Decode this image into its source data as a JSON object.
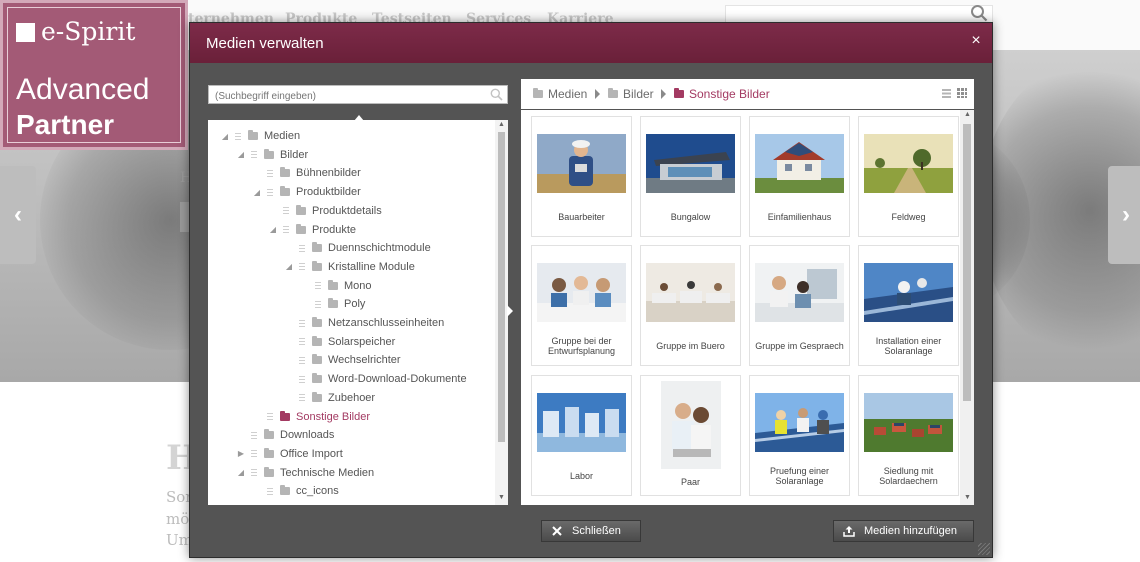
{
  "background": {
    "nav_links": [
      "ternehmen",
      "Produkte",
      "Testseiten",
      "Services",
      "Karriere"
    ],
    "side_heading": "H",
    "heading": "H",
    "paragraph_lines": [
      "Sor",
      "mö",
      "Um"
    ]
  },
  "logo": {
    "brand": "e-Spirit",
    "line1": "Advanced",
    "line2": "Partner"
  },
  "modal": {
    "title": "Medien verwalten",
    "close_glyph": "×",
    "search_placeholder": "(Suchbegriff eingeben)",
    "tree": [
      {
        "label": "Medien",
        "toggle": "◢",
        "active": false
      },
      {
        "label": "Bilder",
        "toggle": "◢",
        "active": false
      },
      {
        "label": "Bühnenbilder",
        "toggle": "",
        "active": false
      },
      {
        "label": "Produktbilder",
        "toggle": "◢",
        "active": false
      },
      {
        "label": "Produktdetails",
        "toggle": "",
        "active": false
      },
      {
        "label": "Produkte",
        "toggle": "◢",
        "active": false
      },
      {
        "label": "Duennschichtmodule",
        "toggle": "",
        "active": false
      },
      {
        "label": "Kristalline Module",
        "toggle": "◢",
        "active": false
      },
      {
        "label": "Mono",
        "toggle": "",
        "active": false
      },
      {
        "label": "Poly",
        "toggle": "",
        "active": false
      },
      {
        "label": "Netzanschlusseinheiten",
        "toggle": "",
        "active": false
      },
      {
        "label": "Solarspeicher",
        "toggle": "",
        "active": false
      },
      {
        "label": "Wechselrichter",
        "toggle": "",
        "active": false
      },
      {
        "label": "Word-Download-Dokumente",
        "toggle": "",
        "active": false
      },
      {
        "label": "Zubehoer",
        "toggle": "",
        "active": false
      },
      {
        "label": "Sonstige Bilder",
        "toggle": "",
        "active": true
      },
      {
        "label": "Downloads",
        "toggle": "",
        "active": false
      },
      {
        "label": "Office Import",
        "toggle": "▶",
        "active": false
      },
      {
        "label": "Technische Medien",
        "toggle": "◢",
        "active": false
      },
      {
        "label": "cc_icons",
        "toggle": "",
        "active": false
      }
    ],
    "breadcrumb": [
      "Medien",
      "Bilder",
      "Sonstige Bilder"
    ],
    "tiles": [
      {
        "label": "Bauarbeiter",
        "thumb": "worker-photo"
      },
      {
        "label": "Bungalow",
        "thumb": "bungalow-photo"
      },
      {
        "label": "Einfamilienhaus",
        "thumb": "house-photo"
      },
      {
        "label": "Feldweg",
        "thumb": "field-photo"
      },
      {
        "label": "Gruppe bei der Entwurfsplanung",
        "thumb": "planning-photo"
      },
      {
        "label": "Gruppe im Buero",
        "thumb": "office-photo"
      },
      {
        "label": "Gruppe im Gespraech",
        "thumb": "meeting-photo"
      },
      {
        "label": "Installation einer Solaranlage",
        "thumb": "installation-photo"
      },
      {
        "label": "Labor",
        "thumb": "lab-photo"
      },
      {
        "label": "Paar",
        "thumb": "couple-photo"
      },
      {
        "label": "Pruefung einer Solaranlage",
        "thumb": "inspection-photo"
      },
      {
        "label": "Siedlung mit Solardaechern",
        "thumb": "settlement-photo"
      }
    ],
    "buttons": {
      "close": "Schließen",
      "add": "Medien hinzufügen"
    }
  },
  "colors": {
    "accent": "#a33a62",
    "header": "#6f2340",
    "dialog_bg": "#545454"
  }
}
